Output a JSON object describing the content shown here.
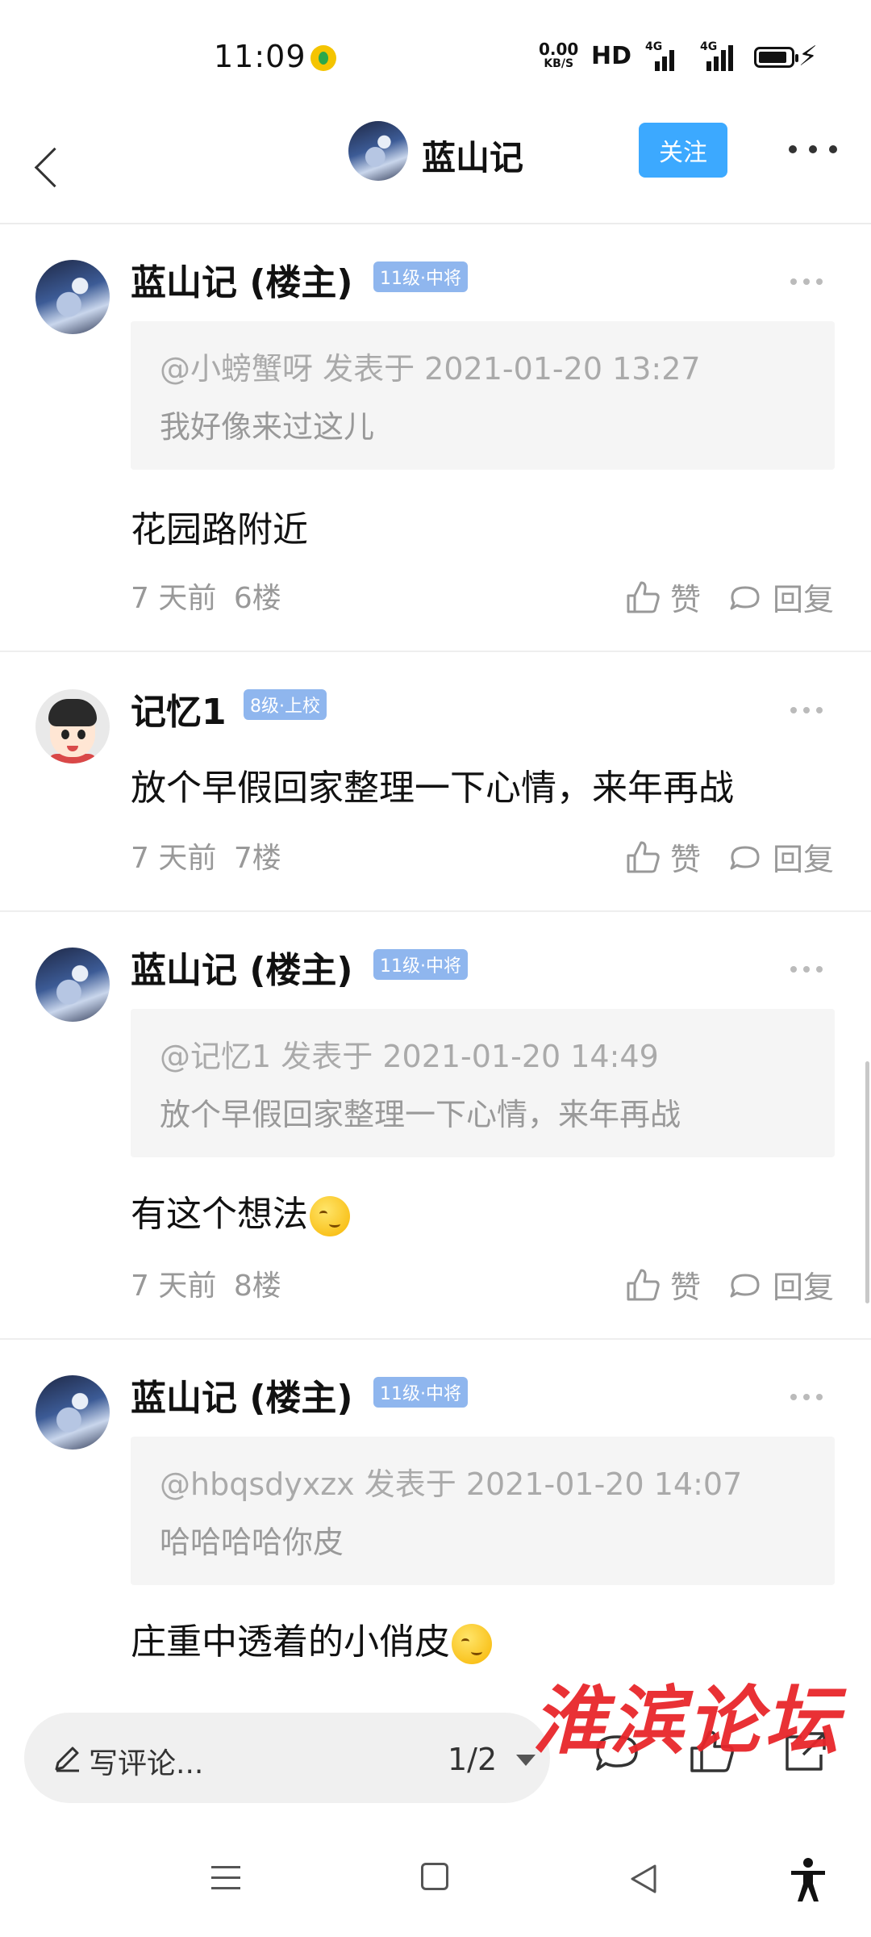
{
  "status_bar": {
    "time": "11:09",
    "net_speed_value": "0.00",
    "net_speed_unit": "KB/S",
    "hd": "HD",
    "signal1_label": "4G",
    "signal2_label": "4G"
  },
  "header": {
    "title": "蓝山记",
    "follow_label": "关注"
  },
  "posts": [
    {
      "name": "蓝山记 (楼主)",
      "badge": "11级·中将",
      "quote_head": "@小螃蟹呀 发表于 2021-01-20 13:27",
      "quote_body": "我好像来过这儿",
      "text": "花园路附近",
      "time": "7 天前",
      "floor": "6楼",
      "like_label": "赞",
      "reply_label": "回复"
    },
    {
      "name": "记忆1",
      "badge": "8级·上校",
      "text": "放个早假回家整理一下心情，来年再战",
      "time": "7 天前",
      "floor": "7楼",
      "like_label": "赞",
      "reply_label": "回复"
    },
    {
      "name": "蓝山记 (楼主)",
      "badge": "11级·中将",
      "quote_head": "@记忆1 发表于 2021-01-20 14:49",
      "quote_body": "放个早假回家整理一下心情，来年再战",
      "text": "有这个想法",
      "time": "7 天前",
      "floor": "8楼",
      "like_label": "赞",
      "reply_label": "回复"
    },
    {
      "name": "蓝山记 (楼主)",
      "badge": "11级·中将",
      "quote_head": "@hbqsdyxzx 发表于 2021-01-20 14:07",
      "quote_body": "哈哈哈哈你皮",
      "text": "庄重中透着的小俏皮"
    }
  ],
  "bottom_bar": {
    "comment_placeholder": "写评论...",
    "page_indicator": "1/2",
    "watermark": "淮滨论坛"
  },
  "colors": {
    "accent": "#3ca9ff",
    "badge": "#8fb6ee",
    "watermark": "#e8262b"
  }
}
